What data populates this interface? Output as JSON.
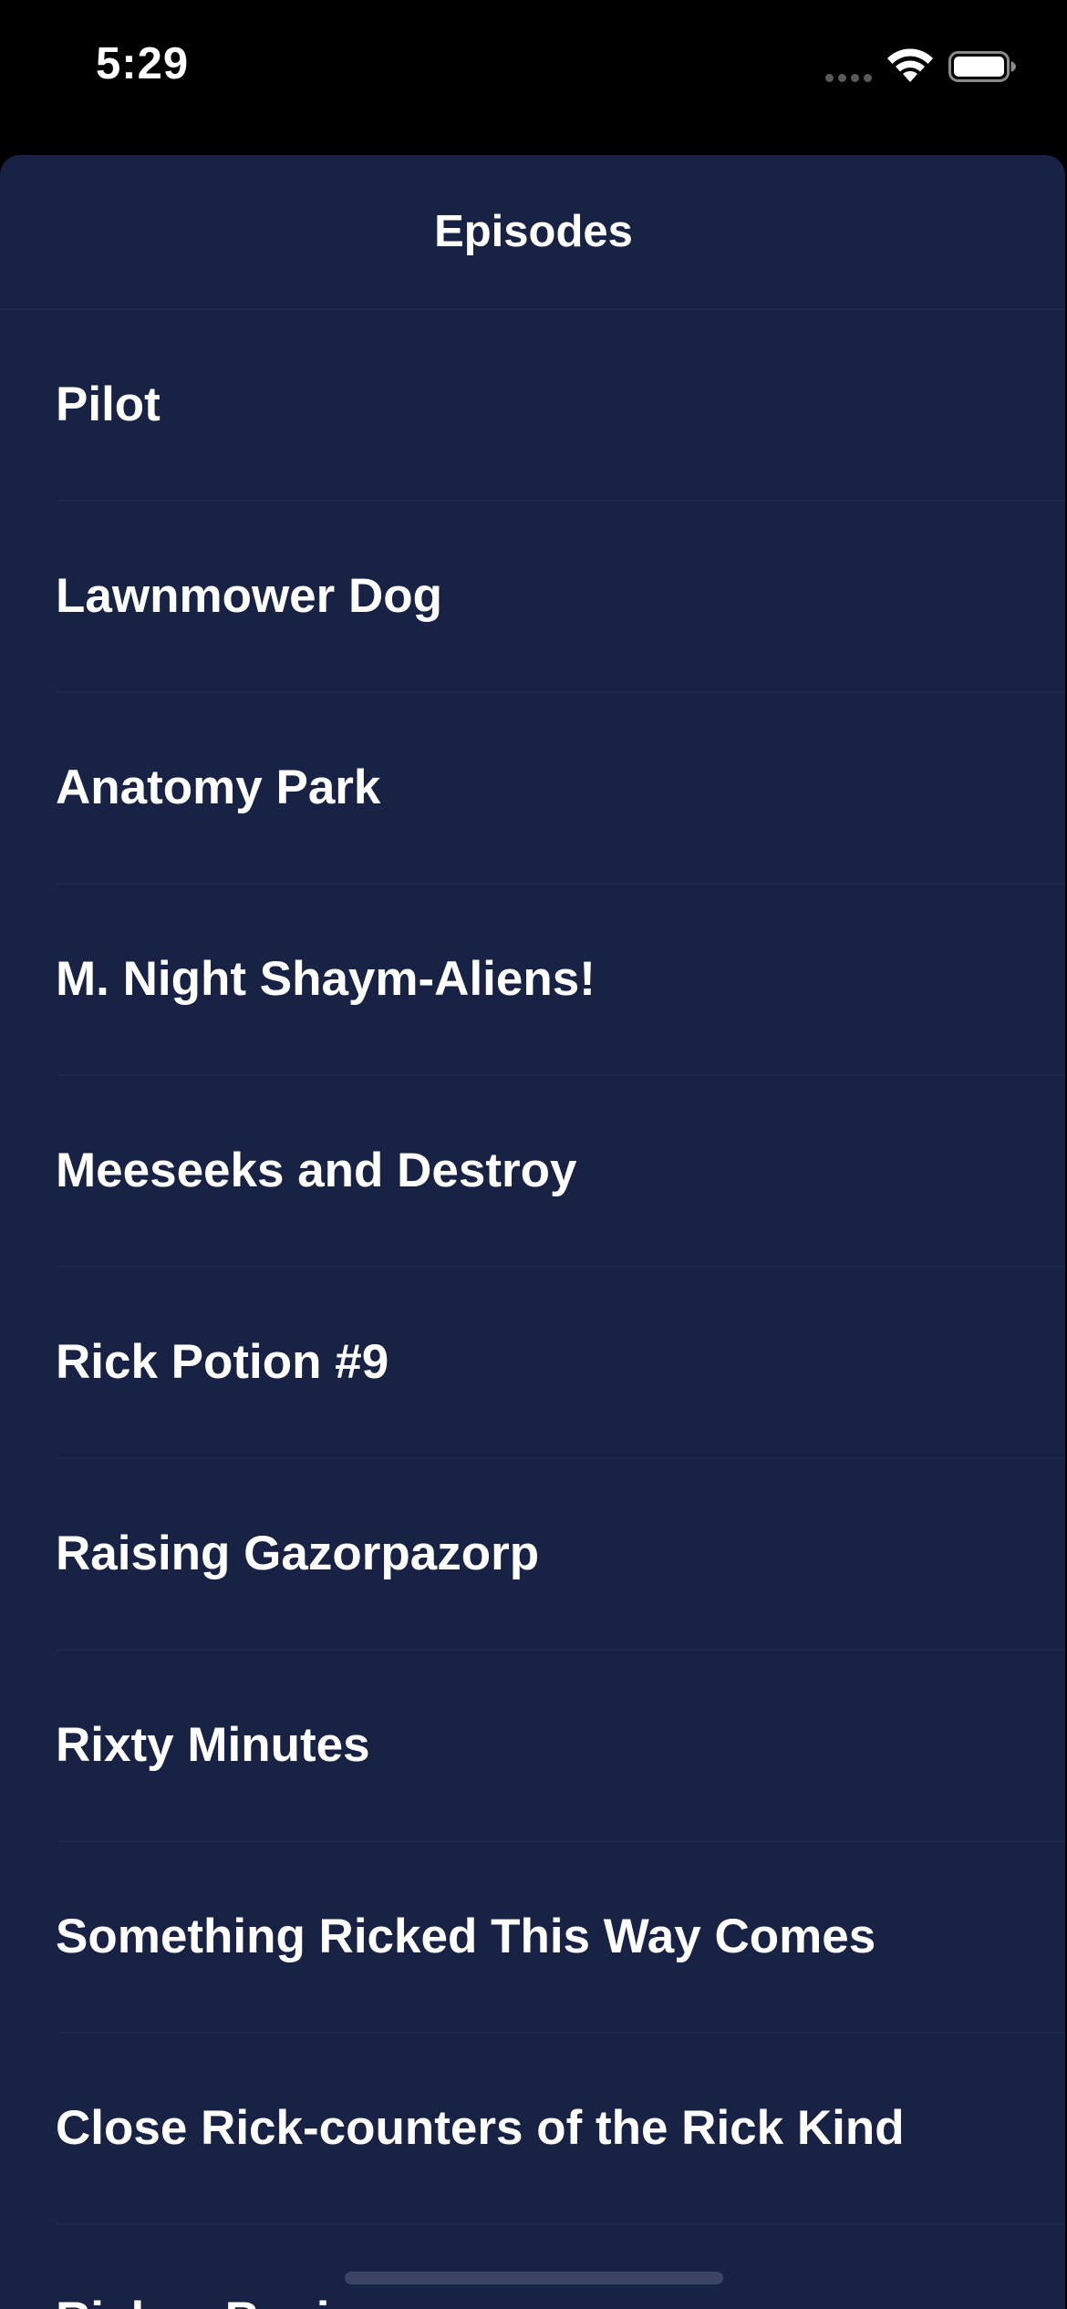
{
  "status_bar": {
    "time": "5:29"
  },
  "sheet": {
    "title": "Episodes"
  },
  "episodes": [
    {
      "label": "Pilot"
    },
    {
      "label": "Lawnmower Dog"
    },
    {
      "label": "Anatomy Park"
    },
    {
      "label": "M. Night Shaym-Aliens!"
    },
    {
      "label": "Meeseeks and Destroy"
    },
    {
      "label": "Rick Potion #9"
    },
    {
      "label": "Raising Gazorpazorp"
    },
    {
      "label": "Rixty Minutes"
    },
    {
      "label": "Something Ricked This Way Comes"
    },
    {
      "label": "Close Rick-counters of the Rick Kind"
    },
    {
      "label": "Ricksy Business"
    }
  ],
  "colors": {
    "background": "#000000",
    "sheet": "#182244",
    "divider": "#1d284b",
    "text": "#ffffff"
  },
  "icons": [
    "wifi-icon",
    "battery-icon",
    "signal-dots-icon"
  ]
}
